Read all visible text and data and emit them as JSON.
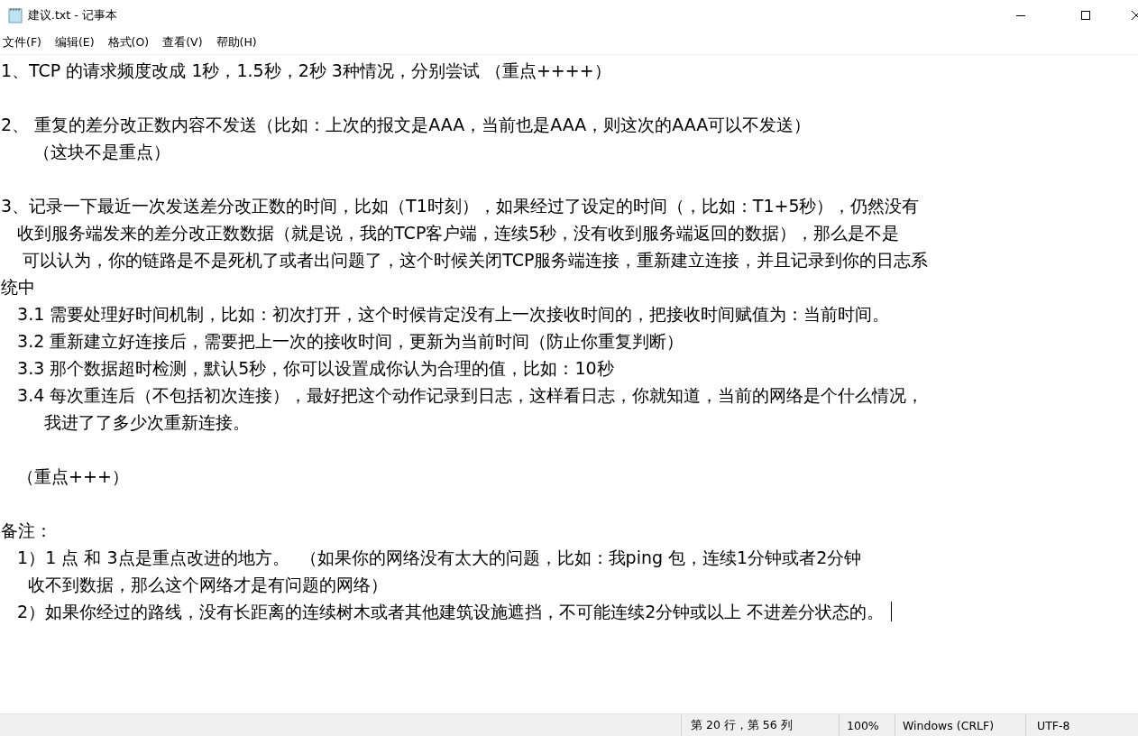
{
  "window": {
    "title": "建议.txt - 记事本"
  },
  "menu": [
    "文件(F)",
    "编辑(E)",
    "格式(O)",
    "查看(V)",
    "帮助(H)"
  ],
  "editor": {
    "lines": [
      {
        "kind": "text",
        "text": "1、TCP 的请求频度改成 1秒，1.5秒，2秒 3种情况，分别尝试 （重点++++）"
      },
      {
        "kind": "blank"
      },
      {
        "kind": "text",
        "text": "2、 重复的差分改正数内容不发送（比如：上次的报文是AAA，当前也是AAA，则这次的AAA可以不发送）"
      },
      {
        "kind": "text",
        "text": "      （这块不是重点）"
      },
      {
        "kind": "blank"
      },
      {
        "kind": "text",
        "text": "3、记录一下最近一次发送差分改正数的时间，比如（T1时刻），如果经过了设定的时间（，比如：T1+5秒），仍然没有"
      },
      {
        "kind": "text",
        "text": "   收到服务端发来的差分改正数数据（就是说，我的TCP客户端，连续5秒，没有收到服务端返回的数据），那么是不是"
      },
      {
        "kind": "text",
        "text": "    可以认为，你的链路是不是死机了或者出问题了，这个时候关闭TCP服务端连接，重新建立连接，并且记录到你的日志系"
      },
      {
        "kind": "text",
        "text": "统中"
      },
      {
        "kind": "text",
        "text": "   3.1 需要处理好时间机制，比如：初次打开，这个时候肯定没有上一次接收时间的，把接收时间赋值为：当前时间。"
      },
      {
        "kind": "text",
        "text": "   3.2 重新建立好连接后，需要把上一次的接收时间，更新为当前时间（防止你重复判断）"
      },
      {
        "kind": "text",
        "text": "   3.3 那个数据超时检测，默认5秒，你可以设置成你认为合理的值，比如：10秒"
      },
      {
        "kind": "text",
        "text": "   3.4 每次重连后（不包括初次连接），最好把这个动作记录到日志，这样看日志，你就知道，当前的网络是个什么情况，"
      },
      {
        "kind": "text",
        "text": "        我进了了多少次重新连接。"
      },
      {
        "kind": "blank"
      },
      {
        "kind": "text",
        "text": "   （重点+++）"
      },
      {
        "kind": "blank"
      },
      {
        "kind": "text",
        "text": "备注："
      },
      {
        "kind": "text",
        "text": "   1）1 点 和 3点是重点改进的地方。  （如果你的网络没有太大的问题，比如：我ping 包，连续1分钟或者2分钟"
      },
      {
        "kind": "text",
        "text": "     收不到数据，那么这个网络才是有问题的网络）"
      },
      {
        "kind": "text",
        "text": "   2）如果你经过的路线，没有长距离的连续树木或者其他建筑设施遮挡，不可能连续2分钟或以上 不进差分状态的。",
        "cursor": true
      }
    ]
  },
  "status_bar": [
    "第 20 行，第 56 列",
    "100%",
    "Windows (CRLF)",
    "UTF-8"
  ]
}
